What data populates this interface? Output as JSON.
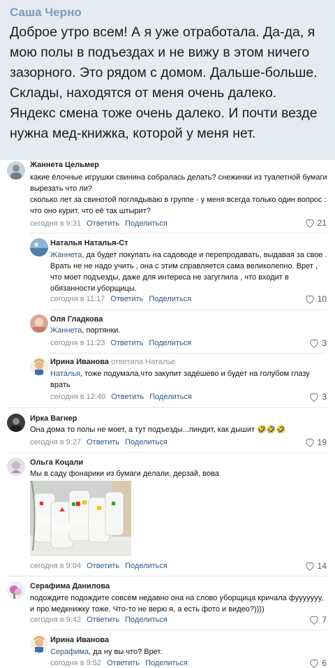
{
  "post": {
    "author": "Саша Черно",
    "text": "Доброе утро всем! А я уже отработала. Да-да, я мою полы в подъездах и не вижу в этом ничего зазорного. Это рядом с домом. Дальше-больше. Склады, находятся от меня очень далеко. Яндекс смена тоже очень далеко. И почти везде нужна мед-книжка, которой у меня нет."
  },
  "actions": {
    "reply": "Ответить",
    "share": "Поделиться"
  },
  "comments": [
    {
      "name": "Жаннета Цельмер",
      "text": "какие ёлочные игрушки свинина собралась делать? снежинки из туалетной бумаги вырезать что ли?\nсколько лет за свинотой поглядываю в группе - у меня всегда только один вопрос : что оно курит, что её так штырит?",
      "time": "сегодня в 9:31",
      "likes": "21"
    },
    {
      "name": "Наталья Наталья-Ст",
      "mention": "Жаннета",
      "text": ", да будет покупать на садоводе и перепродавать, выдавая за свое . Врать не не надо учить , она с этим справляется сама великолепно. Врет , что моет подъезды, даже для интереса не загуглила , что входит в обязанности уборщицы.",
      "time": "сегодня в 11:17",
      "likes": "10"
    },
    {
      "name": "Оля Гладкова",
      "mention": "Жаннета",
      "text": ", портянки.",
      "time": "сегодня в 11:23",
      "likes": "3"
    },
    {
      "name": "Ирина Иванова",
      "reply_to": "ответила Наталье",
      "mention": "Наталья",
      "text": ", тоже подумала,что закупит задёшево и будет на голубом глазу врать",
      "time": "сегодня в 12:40",
      "likes": "3"
    },
    {
      "name": "Ирка Вагнер",
      "text": "Она дома то полы не моет, а тут подъезды...пиндит, как дышит 🤣🤣🤣",
      "time": "сегодня в 9:27",
      "likes": "19"
    },
    {
      "name": "Ольга Коцали",
      "text": "Мы в саду фонарики из бумаги делали, дерзай, вова",
      "time": "сегодня в 9:04",
      "likes": "14"
    },
    {
      "name": "Серафима Данилова",
      "text": "подождите подождите совсем недавно она на слово уборщица кричала фууууууу, и про медкнижку тоже. Что-то не верю я, а есть фото и видео?))))",
      "time": "сегодня в 9:42",
      "likes": "7"
    },
    {
      "name": "Ирина Иванова",
      "mention": "Серафима",
      "text": ", да ну вы что? Врет.",
      "time": "сегодня в 9:52",
      "likes": "6"
    }
  ],
  "colors": {
    "post_bg": "#e5ebf1",
    "link": "#2a5885",
    "meta": "#818c99"
  }
}
